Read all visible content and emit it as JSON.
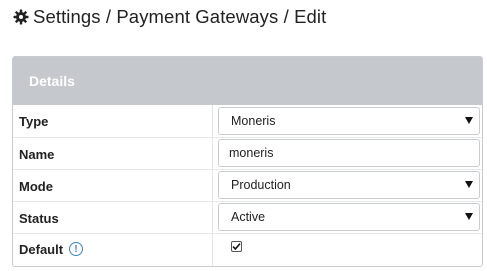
{
  "header": {
    "icon": "gear-icon",
    "title": "Settings / Payment Gateways / Edit"
  },
  "panel": {
    "heading": "Details"
  },
  "fields": {
    "type": {
      "label": "Type",
      "value": "Moneris",
      "icon": "chevron-down-icon"
    },
    "name": {
      "label": "Name",
      "value": "moneris"
    },
    "mode": {
      "label": "Mode",
      "value": "Production",
      "icon": "chevron-down-icon"
    },
    "status": {
      "label": "Status",
      "value": "Active",
      "icon": "chevron-down-icon"
    },
    "default": {
      "label": "Default",
      "info_icon": "info-icon",
      "checked": true
    }
  },
  "colors": {
    "panel_heading_bg": "#c5c8cc",
    "info_accent": "#3a84c9"
  }
}
